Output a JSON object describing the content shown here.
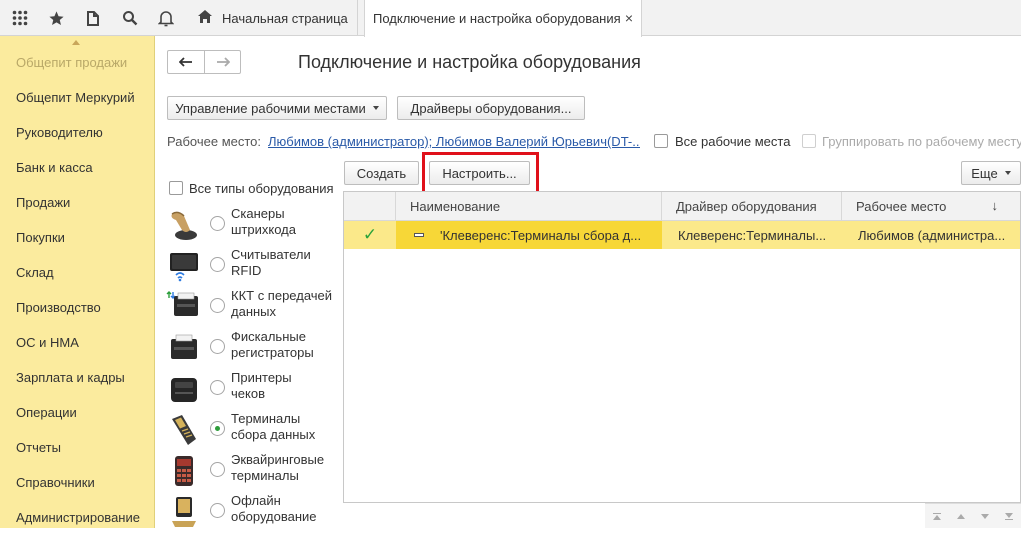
{
  "topbar": {
    "icons": [
      "apps-grid-icon",
      "star-icon",
      "history-icon",
      "search-icon",
      "bell-icon"
    ],
    "tabs": {
      "home": "Начальная страница",
      "active": "Подключение и настройка оборудования",
      "close": "×"
    }
  },
  "sidebar": {
    "items": [
      "Общепит продажи",
      "Общепит Меркурий",
      "Руководителю",
      "Банк и касса",
      "Продажи",
      "Покупки",
      "Склад",
      "Производство",
      "ОС и НМА",
      "Зарплата и кадры",
      "Операции",
      "Отчеты",
      "Справочники",
      "Администрирование"
    ]
  },
  "main": {
    "nav": {
      "back": "🡐",
      "forward": "🡒"
    },
    "title": "Подключение и настройка оборудования",
    "toolbar": {
      "workplaces": "Управление рабочими местами",
      "drivers": "Драйверы оборудования..."
    },
    "workplace": {
      "label": "Рабочее место:",
      "value": "Любимов (администратор); Любимов Валерий Юрьевич(DT-...",
      "all_places": "Все рабочие места",
      "group_by": "Группировать по рабочему месту"
    },
    "actions": {
      "create": "Создать",
      "configure": "Настроить...",
      "more": "Еще"
    },
    "all_types": "Все типы оборудования",
    "device_types": [
      {
        "line1": "Сканеры",
        "line2": "штрихкода",
        "icon": "barcode-scanner-icon",
        "selected": false
      },
      {
        "line1": "Считыватели",
        "line2": "RFID",
        "icon": "rfid-reader-icon",
        "selected": false
      },
      {
        "line1": "ККТ с передачей",
        "line2": "данных",
        "icon": "online-cash-register-icon",
        "selected": false
      },
      {
        "line1": "Фискальные",
        "line2": "регистраторы",
        "icon": "fiscal-printer-icon",
        "selected": false
      },
      {
        "line1": "Принтеры",
        "line2": "чеков",
        "icon": "receipt-printer-icon",
        "selected": false
      },
      {
        "line1": "Терминалы",
        "line2": "сбора данных",
        "icon": "data-terminal-icon",
        "selected": true
      },
      {
        "line1": "Эквайринговые",
        "line2": "терминалы",
        "icon": "pos-terminal-icon",
        "selected": false
      },
      {
        "line1": "Офлайн",
        "line2": "оборудование",
        "icon": "offline-equipment-icon",
        "selected": false
      }
    ],
    "grid": {
      "columns": [
        "Наименование",
        "Драйвер оборудования",
        "Рабочее место"
      ],
      "sort_indicator": "↓",
      "rows": [
        {
          "check": "✓",
          "name": "'Клеверенс:Терминалы сбора д...",
          "driver": "Клеверенс:Терминалы...",
          "workplace": "Любимов (администра..."
        }
      ]
    }
  },
  "colors": {
    "sidebar_bg": "#fbeb9e",
    "row_bg": "#fbe98a",
    "row_selected": "#f7d737",
    "highlight_frame": "#e0101a",
    "link": "#2a5aa8",
    "check": "#2aa33a"
  }
}
